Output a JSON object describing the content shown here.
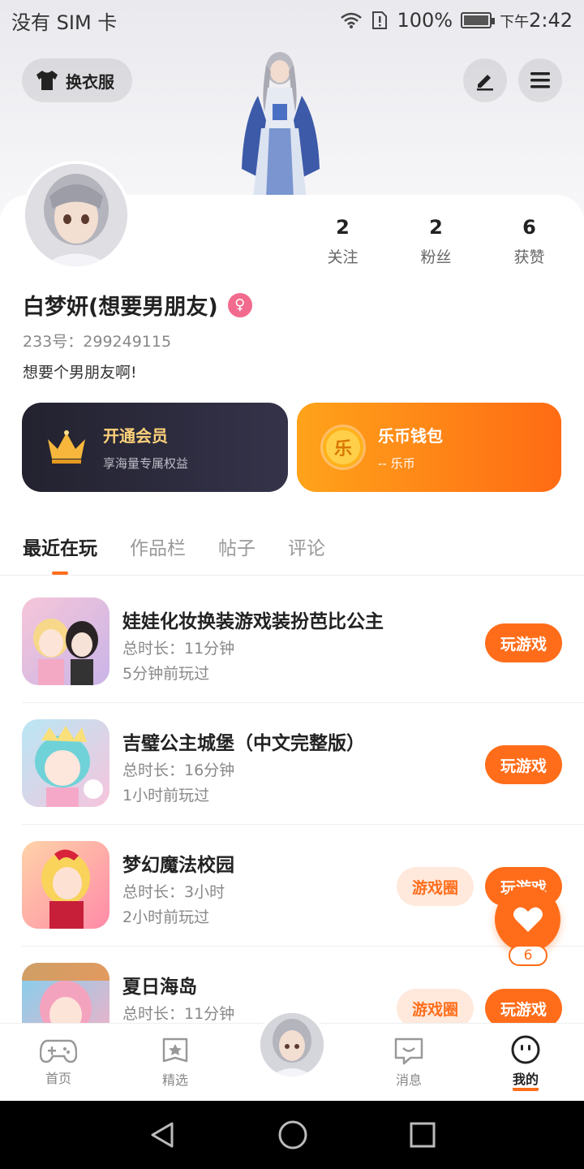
{
  "status_bar": {
    "carrier": "没有 SIM 卡",
    "battery": "100%",
    "time_prefix": "下午",
    "time": "2:42"
  },
  "header": {
    "outfit_label": "换衣服",
    "edit_icon": "pencil-icon",
    "menu_icon": "hamburger-icon"
  },
  "stats": [
    {
      "num": "2",
      "label": "关注"
    },
    {
      "num": "2",
      "label": "粉丝"
    },
    {
      "num": "6",
      "label": "获赞"
    }
  ],
  "profile": {
    "name": "白梦妍(想要男朋友)",
    "gender_icon": "female-icon",
    "uid": "233号：299249115",
    "bio": "想要个男朋友啊!"
  },
  "vip_card": {
    "title": "开通会员",
    "subtitle": "享海量专属权益"
  },
  "wallet_card": {
    "coin_glyph": "乐",
    "title": "乐币钱包",
    "subtitle": "-- 乐币"
  },
  "tabs": [
    "最近在玩",
    "作品栏",
    "帖子",
    "评论"
  ],
  "games": [
    {
      "title": "娃娃化妆换装游戏装扮芭比公主",
      "duration": "总时长：11分钟",
      "last_played": "5分钟前玩过",
      "play_label": "玩游戏"
    },
    {
      "title": "吉璧公主城堡（中文完整版）",
      "duration": "总时长：16分钟",
      "last_played": "1小时前玩过",
      "play_label": "玩游戏"
    },
    {
      "title": "梦幻魔法校园",
      "duration": "总时长：3小时",
      "last_played": "2小时前玩过",
      "circle_label": "游戏圈",
      "play_label": "玩游戏"
    },
    {
      "title": "夏日海岛",
      "duration": "总时长：11分钟",
      "last_played": "",
      "circle_label": "游戏圈",
      "play_label": "玩游戏"
    }
  ],
  "fab": {
    "count": "6"
  },
  "bottom_nav": [
    {
      "label": "首页",
      "icon": "gamepad-icon"
    },
    {
      "label": "精选",
      "icon": "star-bookmark-icon"
    },
    {
      "label": "",
      "icon": "avatar"
    },
    {
      "label": "消息",
      "icon": "chat-icon"
    },
    {
      "label": "我的",
      "icon": "smiley-icon"
    }
  ],
  "colors": {
    "accent": "#ff6d1a",
    "vip_bg": "#23222f",
    "wallet_bg": "#ffa31a"
  }
}
